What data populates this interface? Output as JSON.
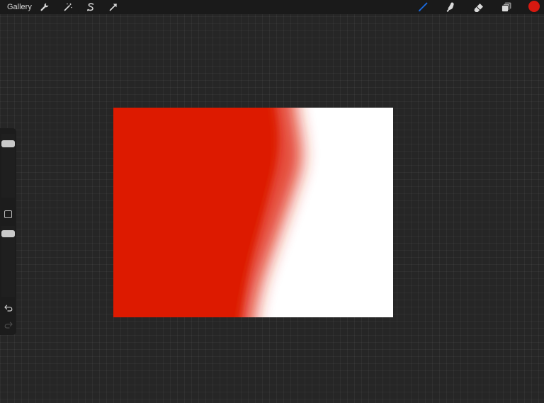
{
  "toolbar": {
    "gallery_label": "Gallery",
    "actions": [
      {
        "name": "actions-wrench",
        "icon": "wrench-icon"
      },
      {
        "name": "adjustments",
        "icon": "magic-wand-icon"
      },
      {
        "name": "selection",
        "icon": "selection-s-icon"
      },
      {
        "name": "transform",
        "icon": "arrow-cursor-icon"
      }
    ],
    "tools": [
      {
        "name": "brush",
        "icon": "brush-icon",
        "active": true
      },
      {
        "name": "smudge",
        "icon": "smudge-finger-icon"
      },
      {
        "name": "eraser",
        "icon": "eraser-icon"
      },
      {
        "name": "layers",
        "icon": "layers-icon"
      }
    ],
    "current_color": "#d71910",
    "active_tool_color": "#1a6ee8"
  },
  "canvas": {
    "background": "#ffffff",
    "paint_color": "#dd1a00"
  },
  "sidebar": {
    "brush_size": 0.75,
    "brush_opacity": 0.95,
    "modify_button_icon": "square-icon",
    "undo_icon": "undo-icon",
    "redo_icon": "redo-icon",
    "redo_enabled": false
  }
}
